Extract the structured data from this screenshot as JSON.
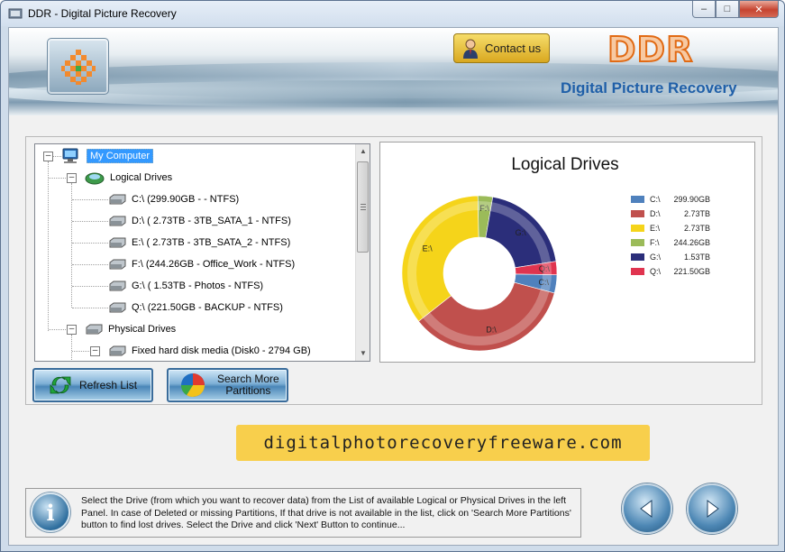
{
  "window": {
    "title": "DDR - Digital Picture Recovery",
    "controls": {
      "minimize": "–",
      "maximize": "□",
      "close": "✕"
    }
  },
  "header": {
    "contact_label": "Contact us",
    "brand": "DDR",
    "subtitle": "Digital Picture Recovery"
  },
  "tree": {
    "root": "My Computer",
    "logical_group": "Logical Drives",
    "logical_drives": [
      "C:\\ (299.90GB -  - NTFS)",
      "D:\\ ( 2.73TB - 3TB_SATA_1 - NTFS)",
      "E:\\ ( 2.73TB - 3TB_SATA_2 - NTFS)",
      "F:\\ (244.26GB - Office_Work - NTFS)",
      "G:\\ ( 1.53TB - Photos - NTFS)",
      "Q:\\ (221.50GB - BACKUP - NTFS)"
    ],
    "physical_group": "Physical Drives",
    "physical_drives": [
      "Fixed hard disk media (Disk0 - 2794 GB)"
    ]
  },
  "chart_data": {
    "type": "pie",
    "style": "donut",
    "title": "Logical Drives",
    "categories": [
      "C:\\",
      "D:\\",
      "E:\\",
      "F:\\",
      "G:\\",
      "Q:\\"
    ],
    "values": [
      299.9,
      2795.52,
      2795.52,
      244.26,
      1566.72,
      221.5
    ],
    "value_labels": [
      "299.90GB",
      "2.73TB",
      "2.73TB",
      "244.26GB",
      "1.53TB",
      "221.50GB"
    ],
    "colors": [
      "#4f81bd",
      "#c0504d",
      "#f5d41a",
      "#9bbb59",
      "#2b2e7a",
      "#e0344f"
    ],
    "legend_position": "right"
  },
  "buttons": {
    "refresh": "Refresh List",
    "search_more_line1": "Search More",
    "search_more_line2": "Partitions"
  },
  "url": "digitalphotorecoveryfreeware.com",
  "info": {
    "text": "Select the Drive (from which you want to recover data) from the List of available Logical or Physical Drives in the left Panel. In case of Deleted or missing Partitions, If that drive is not available in the list, click on 'Search More Partitions' button to find lost drives. Select the Drive and click 'Next' Button to continue..."
  },
  "icons": {
    "info": "i"
  }
}
